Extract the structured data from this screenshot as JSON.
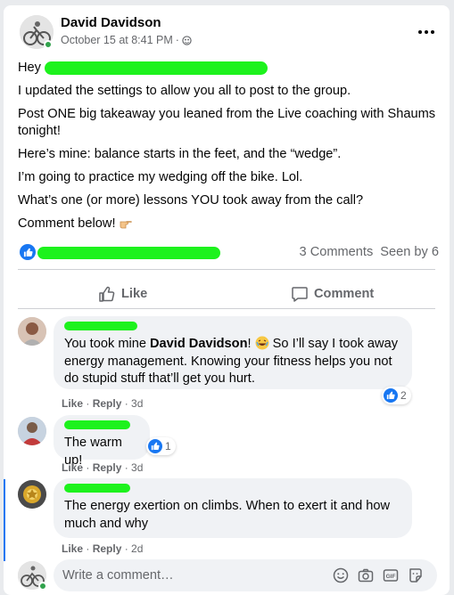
{
  "post": {
    "author": "David Davidson",
    "timestamp": "October 15 at 8:41 PM",
    "audience_icon": "group-icon",
    "greeting": "Hey",
    "paragraphs": [
      "I updated the settings to allow you all to post to the group.",
      "Post ONE big takeaway you leaned from the Live coaching with Shaums tonight!",
      "Here’s mine: balance starts in the feet, and the “wedge”.",
      "I’m going to practice my wedging off the bike. Lol.",
      "What’s one (or more) lessons YOU took away from the call?"
    ],
    "last_line": "Comment below!",
    "comments_count": "3 Comments",
    "seen_by": "Seen by 6"
  },
  "actions": {
    "like": "Like",
    "comment": "Comment"
  },
  "comments": [
    {
      "text_before": "You took mine ",
      "mention": "David Davidson",
      "text_mid": "! ",
      "text_after": " So I’ll say I took away energy management. Knowing your fitness helps you not do stupid stuff that’ll get you hurt.",
      "like": "Like",
      "reply": "Reply",
      "time": "3d",
      "reactions": "2"
    },
    {
      "text": "The warm up!",
      "like": "Like",
      "reply": "Reply",
      "time": "3d",
      "reactions": "1"
    },
    {
      "text": "The energy exertion on climbs. When to exert it and how much and why",
      "like": "Like",
      "reply": "Reply",
      "time": "2d"
    }
  ],
  "composer": {
    "placeholder": "Write a comment…",
    "tools": [
      "emoji-icon",
      "camera-icon",
      "gif-icon",
      "sticker-icon"
    ]
  },
  "colors": {
    "accent": "#1877f2",
    "online": "#31a24c",
    "redaction": "#1df21d",
    "muted_text": "#65676b"
  }
}
